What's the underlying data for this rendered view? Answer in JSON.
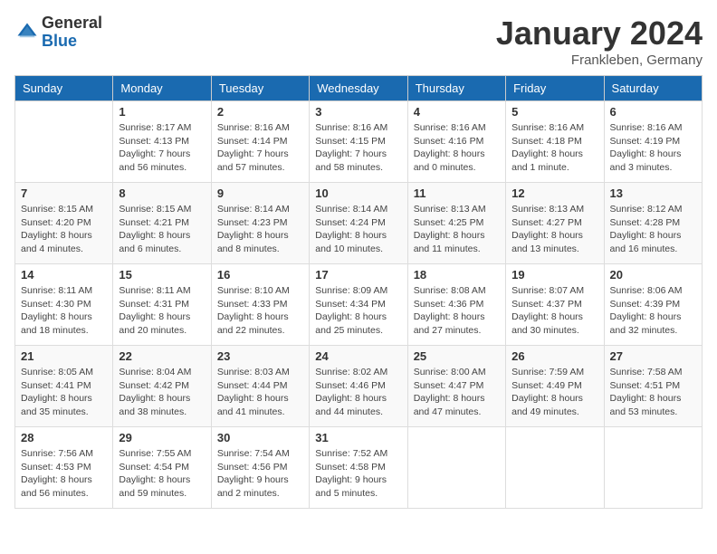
{
  "header": {
    "logo_general": "General",
    "logo_blue": "Blue",
    "month_title": "January 2024",
    "location": "Frankleben, Germany"
  },
  "weekdays": [
    "Sunday",
    "Monday",
    "Tuesday",
    "Wednesday",
    "Thursday",
    "Friday",
    "Saturday"
  ],
  "weeks": [
    [
      {
        "day": "",
        "sunrise": "",
        "sunset": "",
        "daylight": ""
      },
      {
        "day": "1",
        "sunrise": "Sunrise: 8:17 AM",
        "sunset": "Sunset: 4:13 PM",
        "daylight": "Daylight: 7 hours and 56 minutes."
      },
      {
        "day": "2",
        "sunrise": "Sunrise: 8:16 AM",
        "sunset": "Sunset: 4:14 PM",
        "daylight": "Daylight: 7 hours and 57 minutes."
      },
      {
        "day": "3",
        "sunrise": "Sunrise: 8:16 AM",
        "sunset": "Sunset: 4:15 PM",
        "daylight": "Daylight: 7 hours and 58 minutes."
      },
      {
        "day": "4",
        "sunrise": "Sunrise: 8:16 AM",
        "sunset": "Sunset: 4:16 PM",
        "daylight": "Daylight: 8 hours and 0 minutes."
      },
      {
        "day": "5",
        "sunrise": "Sunrise: 8:16 AM",
        "sunset": "Sunset: 4:18 PM",
        "daylight": "Daylight: 8 hours and 1 minute."
      },
      {
        "day": "6",
        "sunrise": "Sunrise: 8:16 AM",
        "sunset": "Sunset: 4:19 PM",
        "daylight": "Daylight: 8 hours and 3 minutes."
      }
    ],
    [
      {
        "day": "7",
        "sunrise": "Sunrise: 8:15 AM",
        "sunset": "Sunset: 4:20 PM",
        "daylight": "Daylight: 8 hours and 4 minutes."
      },
      {
        "day": "8",
        "sunrise": "Sunrise: 8:15 AM",
        "sunset": "Sunset: 4:21 PM",
        "daylight": "Daylight: 8 hours and 6 minutes."
      },
      {
        "day": "9",
        "sunrise": "Sunrise: 8:14 AM",
        "sunset": "Sunset: 4:23 PM",
        "daylight": "Daylight: 8 hours and 8 minutes."
      },
      {
        "day": "10",
        "sunrise": "Sunrise: 8:14 AM",
        "sunset": "Sunset: 4:24 PM",
        "daylight": "Daylight: 8 hours and 10 minutes."
      },
      {
        "day": "11",
        "sunrise": "Sunrise: 8:13 AM",
        "sunset": "Sunset: 4:25 PM",
        "daylight": "Daylight: 8 hours and 11 minutes."
      },
      {
        "day": "12",
        "sunrise": "Sunrise: 8:13 AM",
        "sunset": "Sunset: 4:27 PM",
        "daylight": "Daylight: 8 hours and 13 minutes."
      },
      {
        "day": "13",
        "sunrise": "Sunrise: 8:12 AM",
        "sunset": "Sunset: 4:28 PM",
        "daylight": "Daylight: 8 hours and 16 minutes."
      }
    ],
    [
      {
        "day": "14",
        "sunrise": "Sunrise: 8:11 AM",
        "sunset": "Sunset: 4:30 PM",
        "daylight": "Daylight: 8 hours and 18 minutes."
      },
      {
        "day": "15",
        "sunrise": "Sunrise: 8:11 AM",
        "sunset": "Sunset: 4:31 PM",
        "daylight": "Daylight: 8 hours and 20 minutes."
      },
      {
        "day": "16",
        "sunrise": "Sunrise: 8:10 AM",
        "sunset": "Sunset: 4:33 PM",
        "daylight": "Daylight: 8 hours and 22 minutes."
      },
      {
        "day": "17",
        "sunrise": "Sunrise: 8:09 AM",
        "sunset": "Sunset: 4:34 PM",
        "daylight": "Daylight: 8 hours and 25 minutes."
      },
      {
        "day": "18",
        "sunrise": "Sunrise: 8:08 AM",
        "sunset": "Sunset: 4:36 PM",
        "daylight": "Daylight: 8 hours and 27 minutes."
      },
      {
        "day": "19",
        "sunrise": "Sunrise: 8:07 AM",
        "sunset": "Sunset: 4:37 PM",
        "daylight": "Daylight: 8 hours and 30 minutes."
      },
      {
        "day": "20",
        "sunrise": "Sunrise: 8:06 AM",
        "sunset": "Sunset: 4:39 PM",
        "daylight": "Daylight: 8 hours and 32 minutes."
      }
    ],
    [
      {
        "day": "21",
        "sunrise": "Sunrise: 8:05 AM",
        "sunset": "Sunset: 4:41 PM",
        "daylight": "Daylight: 8 hours and 35 minutes."
      },
      {
        "day": "22",
        "sunrise": "Sunrise: 8:04 AM",
        "sunset": "Sunset: 4:42 PM",
        "daylight": "Daylight: 8 hours and 38 minutes."
      },
      {
        "day": "23",
        "sunrise": "Sunrise: 8:03 AM",
        "sunset": "Sunset: 4:44 PM",
        "daylight": "Daylight: 8 hours and 41 minutes."
      },
      {
        "day": "24",
        "sunrise": "Sunrise: 8:02 AM",
        "sunset": "Sunset: 4:46 PM",
        "daylight": "Daylight: 8 hours and 44 minutes."
      },
      {
        "day": "25",
        "sunrise": "Sunrise: 8:00 AM",
        "sunset": "Sunset: 4:47 PM",
        "daylight": "Daylight: 8 hours and 47 minutes."
      },
      {
        "day": "26",
        "sunrise": "Sunrise: 7:59 AM",
        "sunset": "Sunset: 4:49 PM",
        "daylight": "Daylight: 8 hours and 49 minutes."
      },
      {
        "day": "27",
        "sunrise": "Sunrise: 7:58 AM",
        "sunset": "Sunset: 4:51 PM",
        "daylight": "Daylight: 8 hours and 53 minutes."
      }
    ],
    [
      {
        "day": "28",
        "sunrise": "Sunrise: 7:56 AM",
        "sunset": "Sunset: 4:53 PM",
        "daylight": "Daylight: 8 hours and 56 minutes."
      },
      {
        "day": "29",
        "sunrise": "Sunrise: 7:55 AM",
        "sunset": "Sunset: 4:54 PM",
        "daylight": "Daylight: 8 hours and 59 minutes."
      },
      {
        "day": "30",
        "sunrise": "Sunrise: 7:54 AM",
        "sunset": "Sunset: 4:56 PM",
        "daylight": "Daylight: 9 hours and 2 minutes."
      },
      {
        "day": "31",
        "sunrise": "Sunrise: 7:52 AM",
        "sunset": "Sunset: 4:58 PM",
        "daylight": "Daylight: 9 hours and 5 minutes."
      },
      {
        "day": "",
        "sunrise": "",
        "sunset": "",
        "daylight": ""
      },
      {
        "day": "",
        "sunrise": "",
        "sunset": "",
        "daylight": ""
      },
      {
        "day": "",
        "sunrise": "",
        "sunset": "",
        "daylight": ""
      }
    ]
  ]
}
